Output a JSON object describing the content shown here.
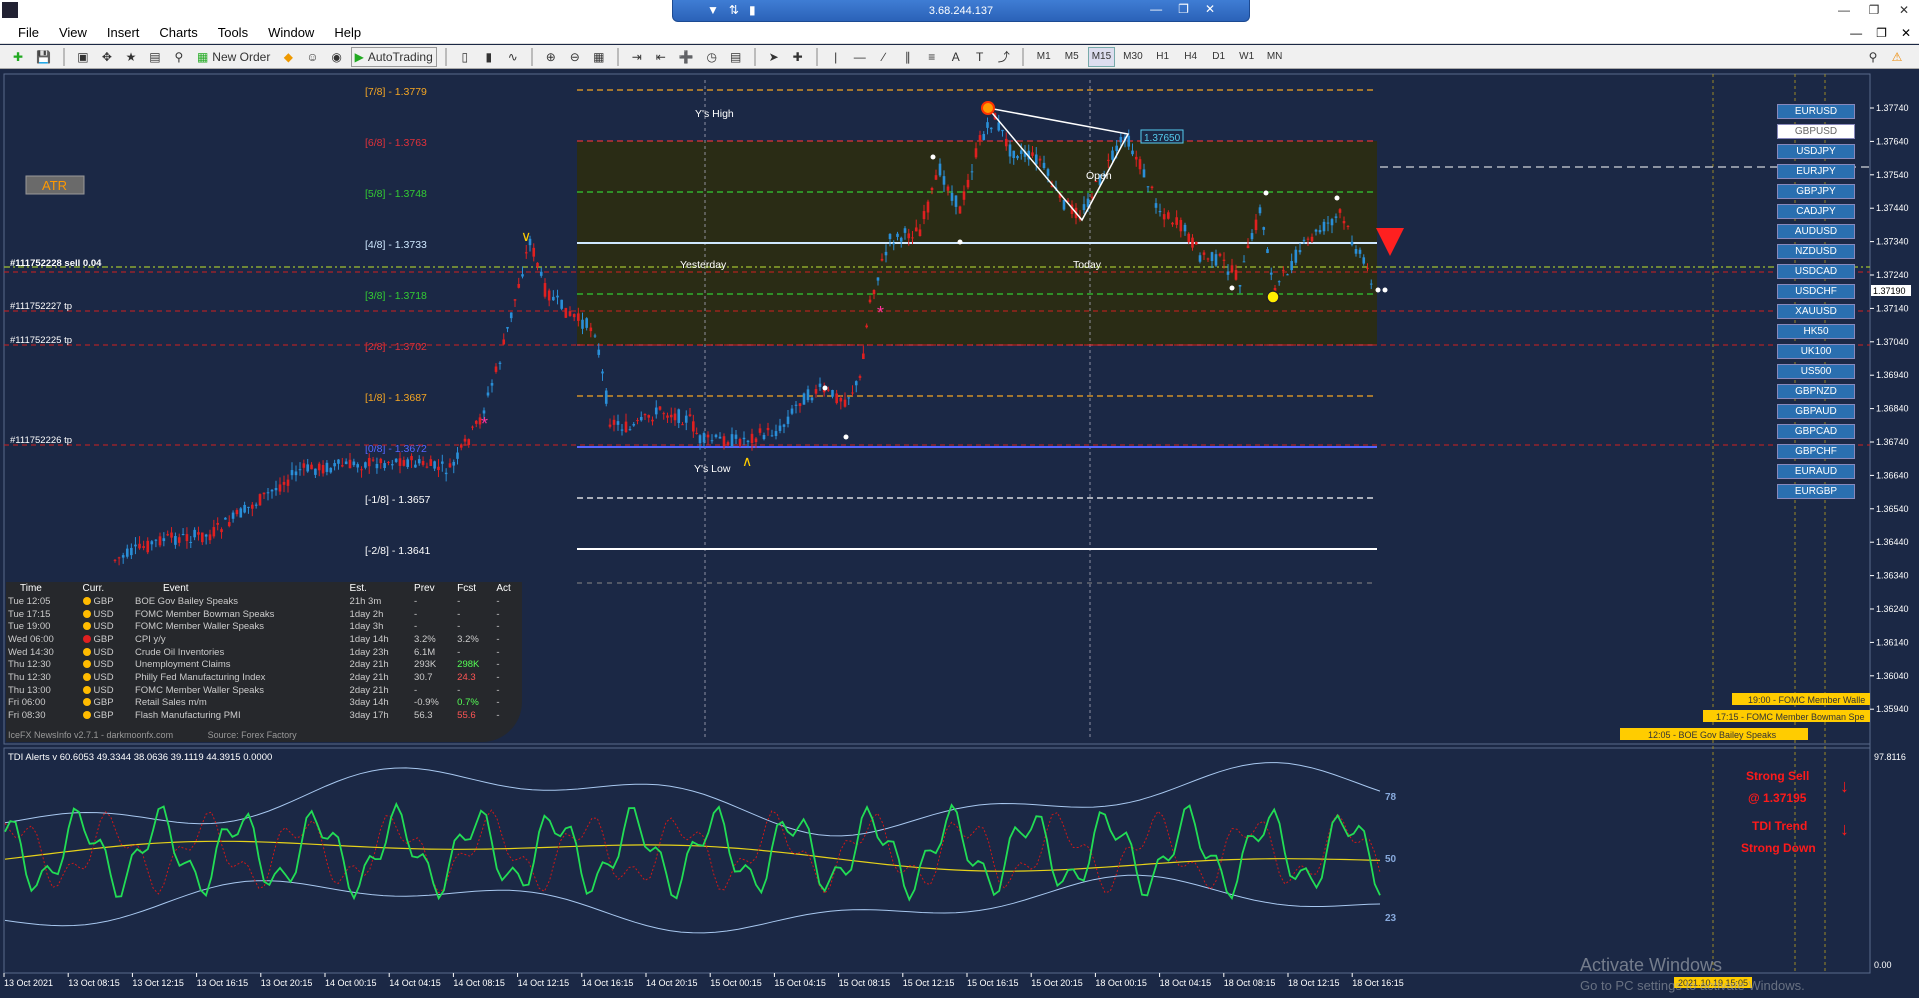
{
  "remote_bar": {
    "ip": "3.68.244.137",
    "left_icons": [
      "chevron-down-icon",
      "pin-icon",
      "signal-icon"
    ],
    "right_icons": [
      "minimize-icon",
      "restore-icon",
      "close-icon"
    ]
  },
  "menu": [
    "File",
    "View",
    "Insert",
    "Charts",
    "Tools",
    "Window",
    "Help"
  ],
  "toolbar": {
    "new_order": "New Order",
    "autotrading": "AutoTrading",
    "timeframes": [
      "M1",
      "M5",
      "M15",
      "M30",
      "H1",
      "H4",
      "D1",
      "W1",
      "MN"
    ],
    "active_timeframe": "M15"
  },
  "indicator_buttons": {
    "atr": "ATR"
  },
  "murrey_levels": [
    {
      "label": "[7/8] - 1.3779",
      "color": "#f5a623"
    },
    {
      "label": "[6/8] - 1.3763",
      "color": "#e0313a"
    },
    {
      "label": "[5/8] - 1.3748",
      "color": "#33cc33"
    },
    {
      "label": "[4/8] - 1.3733",
      "color": "#cfe8ff"
    },
    {
      "label": "[3/8] - 1.3718",
      "color": "#33cc33"
    },
    {
      "label": "[2/8] - 1.3702",
      "color": "#e0313a"
    },
    {
      "label": "[1/8] - 1.3687",
      "color": "#f5a623"
    },
    {
      "label": "[0/8] - 1.3672",
      "color": "#5566ff"
    },
    {
      "label": "[-1/8] - 1.3657",
      "color": "#ffffff"
    },
    {
      "label": "[-2/8] - 1.3641",
      "color": "#ffffff"
    }
  ],
  "chart_labels": {
    "y_high": "Y's High",
    "y_low": "Y's Low",
    "yesterday": "Yesterday",
    "today": "Today",
    "open": "Open",
    "price_tag": "1.37650",
    "order_sell": "#111752228 sell 0.04",
    "tp1": "#111752227 tp",
    "tp2": "#111752225 tp",
    "tp3": "#111752226 tp",
    "current_price": "1.37190"
  },
  "price_axis": [
    "1.37740",
    "1.37640",
    "1.37540",
    "1.37440",
    "1.37340",
    "1.37240",
    "1.37140",
    "1.37040",
    "1.36940",
    "1.36840",
    "1.36740",
    "1.36640",
    "1.36540",
    "1.36440",
    "1.36340",
    "1.36240",
    "1.36140",
    "1.36040",
    "1.35940"
  ],
  "time_axis": [
    "13 Oct 2021",
    "13 Oct 08:15",
    "13 Oct 12:15",
    "13 Oct 16:15",
    "13 Oct 20:15",
    "14 Oct 00:15",
    "14 Oct 04:15",
    "14 Oct 08:15",
    "14 Oct 12:15",
    "14 Oct 16:15",
    "14 Oct 20:15",
    "15 Oct 00:15",
    "15 Oct 04:15",
    "15 Oct 08:15",
    "15 Oct 12:15",
    "15 Oct 16:15",
    "15 Oct 20:15",
    "18 Oct 00:15",
    "18 Oct 04:15",
    "18 Oct 08:15",
    "18 Oct 12:15",
    "18 Oct 16:15"
  ],
  "symbols": [
    "EURUSD",
    "GBPUSD",
    "USDJPY",
    "EURJPY",
    "GBPJPY",
    "CADJPY",
    "AUDUSD",
    "NZDUSD",
    "USDCAD",
    "USDCHF",
    "XAUUSD",
    "HK50",
    "UK100",
    "US500",
    "GBPNZD",
    "GBPAUD",
    "GBPCAD",
    "GBPCHF",
    "EURAUD",
    "EURGBP"
  ],
  "selected_symbol": "GBPUSD",
  "news": {
    "headers": [
      "Time",
      "Curr.",
      "Event",
      "Est.",
      "Prev",
      "Fcst",
      "Act"
    ],
    "rows": [
      [
        "Tue",
        "12:05",
        "GBP",
        "BOE Gov Bailey Speaks",
        "21h 3m",
        "-",
        "-",
        "-"
      ],
      [
        "Tue",
        "17:15",
        "USD",
        "FOMC Member Bowman Speaks",
        "1day 2h",
        "-",
        "-",
        "-"
      ],
      [
        "Tue",
        "19:00",
        "USD",
        "FOMC Member Waller Speaks",
        "1day 3h",
        "-",
        "-",
        "-"
      ],
      [
        "Wed",
        "06:00",
        "GBP",
        "CPI y/y",
        "1day 14h",
        "3.2%",
        "3.2%",
        "-"
      ],
      [
        "Wed",
        "14:30",
        "USD",
        "Crude Oil Inventories",
        "1day 23h",
        "6.1M",
        "-",
        "-"
      ],
      [
        "Thu",
        "12:30",
        "USD",
        "Unemployment Claims",
        "2day 21h",
        "293K",
        "298K",
        "-"
      ],
      [
        "Thu",
        "12:30",
        "USD",
        "Philly Fed Manufacturing Index",
        "2day 21h",
        "30.7",
        "24.3",
        "-"
      ],
      [
        "Thu",
        "13:00",
        "USD",
        "FOMC Member Waller Speaks",
        "2day 21h",
        "-",
        "-",
        "-"
      ],
      [
        "Fri",
        "06:00",
        "GBP",
        "Retail Sales m/m",
        "3day 14h",
        "-0.9%",
        "0.7%",
        "-"
      ],
      [
        "Fri",
        "08:30",
        "GBP",
        "Flash Manufacturing PMI",
        "3day 17h",
        "56.3",
        "55.6",
        "-"
      ]
    ],
    "footer_left": "IceFX NewsInfo v2.7.1 - darkmoonfx.com",
    "footer_right": "Source: Forex Factory"
  },
  "event_tags": [
    "19:00 - FOMC Member Walle",
    "17:15 - FOMC Member Bowman Spe",
    "12:05 - BOE Gov Bailey Speaks"
  ],
  "tdi": {
    "title": "TDI Alerts v 60.6053 49.3344 38.0636 39.1119 44.3915 0.0000",
    "levels": [
      "78",
      "50",
      "23"
    ],
    "signal1": "Strong Sell",
    "signal1b": "@ 1.37195",
    "signal2": "TDI Trend",
    "signal2b": "Strong Down",
    "axis_top": "97.8116",
    "axis_bottom": "0.00"
  },
  "time_tag": "2021.10.19 15:05",
  "watermark": {
    "line1": "Activate Windows",
    "line2": "Go to PC settings to activate Windows."
  }
}
